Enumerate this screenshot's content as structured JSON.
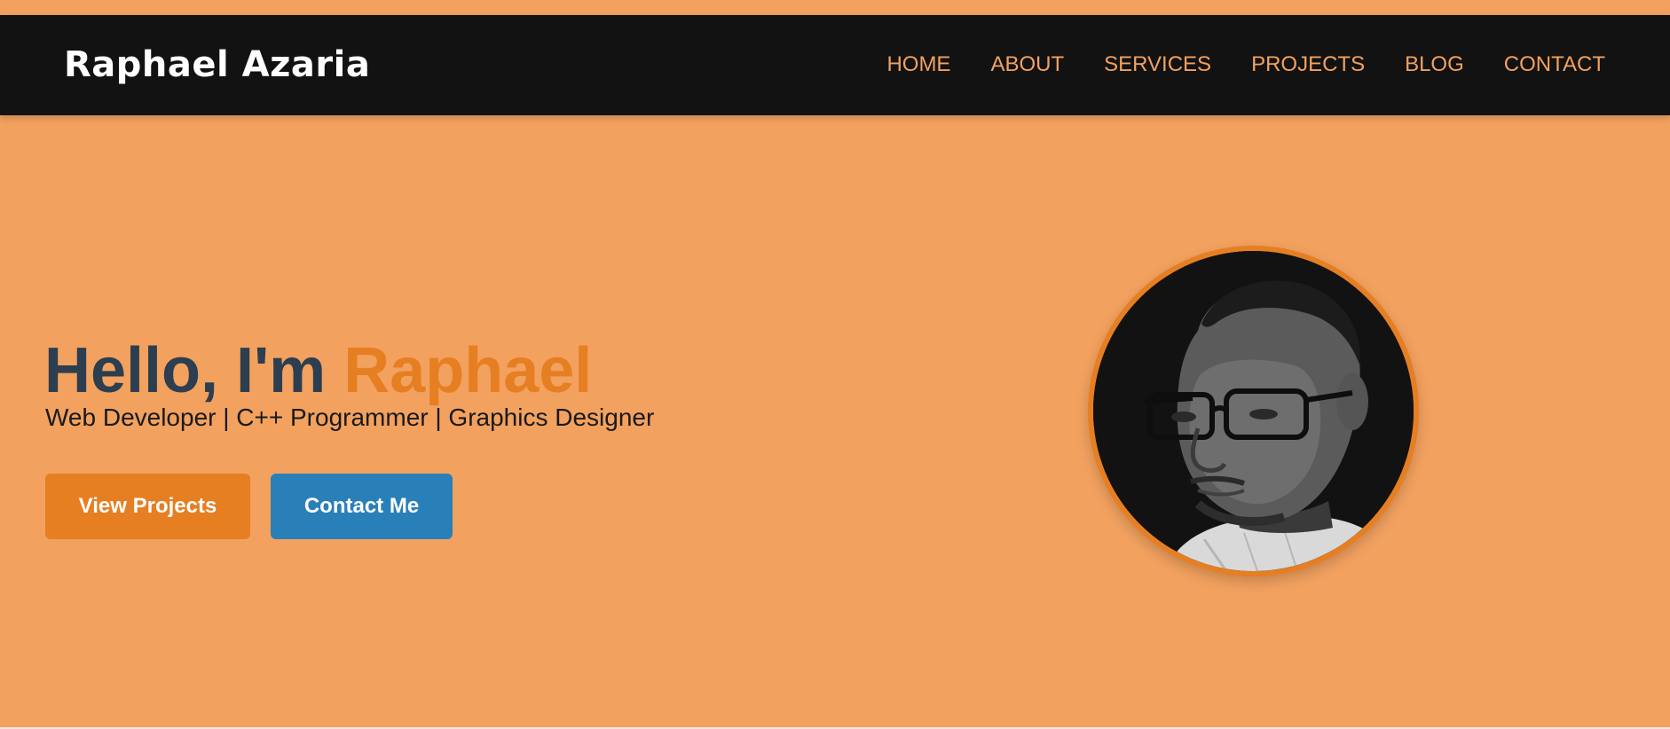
{
  "header": {
    "brand": "Raphael Azaria",
    "nav": [
      {
        "label": "HOME"
      },
      {
        "label": "ABOUT"
      },
      {
        "label": "SERVICES"
      },
      {
        "label": "PROJECTS"
      },
      {
        "label": "BLOG"
      },
      {
        "label": "CONTACT"
      }
    ]
  },
  "hero": {
    "greeting": "Hello, I'm",
    "name": "Raphael",
    "subtitle": "Web Developer | C++ Programmer | Graphics Designer",
    "buttons": {
      "view_projects": "View Projects",
      "contact_me": "Contact Me"
    }
  },
  "colors": {
    "page_background": "#f2a15f",
    "header_background": "#121212",
    "nav_text": "#f2a15f",
    "title_text": "#2c3e50",
    "accent": "#e67e22",
    "secondary_button": "#2980b9"
  },
  "icons": {
    "profile_photo": "profile-photo"
  }
}
